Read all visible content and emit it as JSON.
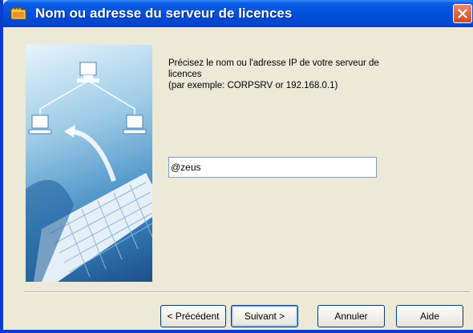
{
  "window": {
    "title": "Nom ou adresse du serveur de licences"
  },
  "prompt": {
    "line1": "Précisez le nom ou l'adresse IP de votre serveur de",
    "line2": "licences",
    "line3": "(par exemple: CORPSRV or 192.168.0.1)"
  },
  "server_field": {
    "value": "@zeus"
  },
  "buttons": {
    "previous": "< Précédent",
    "next": "Suivant >",
    "cancel": "Annuler",
    "help": "Aide"
  },
  "colors": {
    "titlebar": "#0050dc",
    "close": "#c94a22",
    "dialog_bg": "#ece9d8"
  },
  "icons": [
    "app-icon",
    "close-icon",
    "network-computer-icon",
    "keyboard-image"
  ]
}
